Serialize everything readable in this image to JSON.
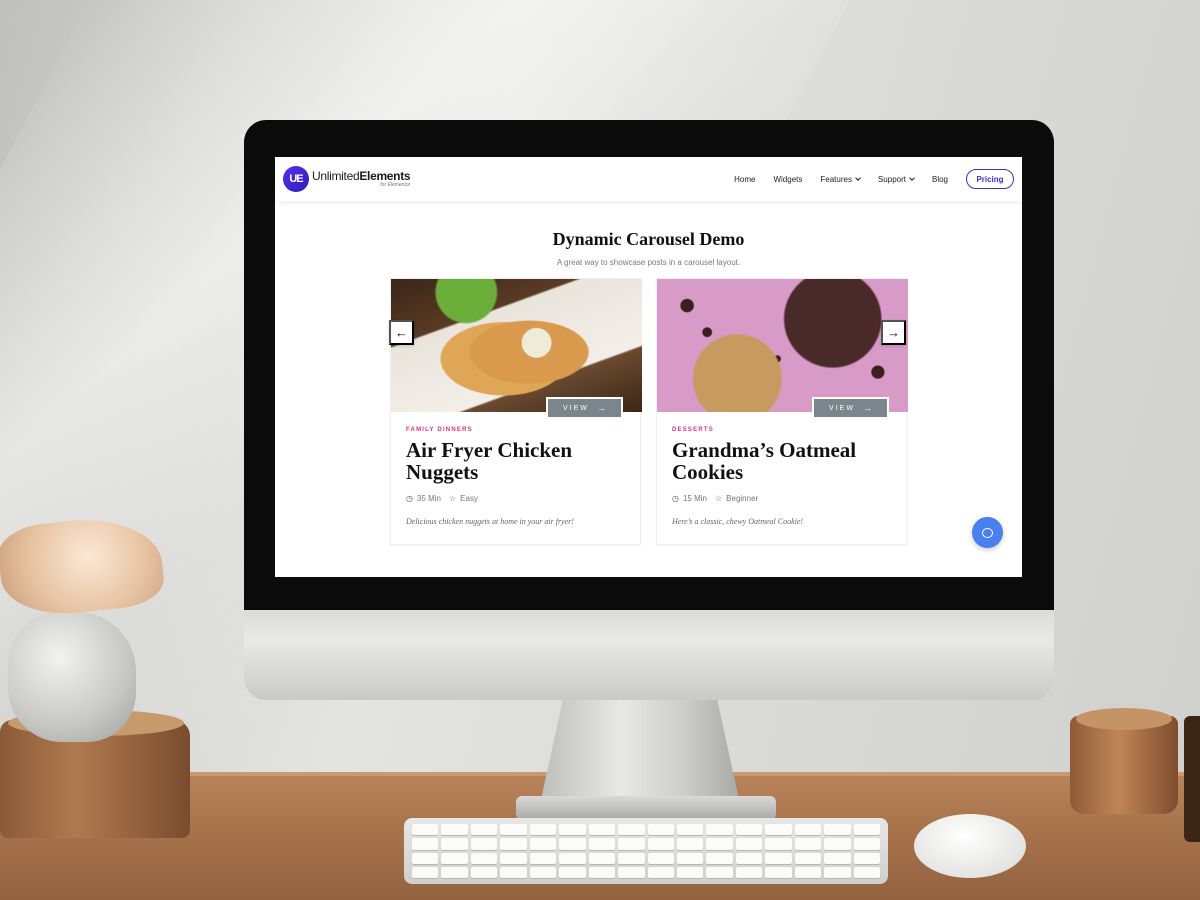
{
  "site": {
    "logo": {
      "mark": "UE",
      "brand_light": "Unlimited",
      "brand_bold": "Elements",
      "tagline": "for Elementor"
    },
    "nav": {
      "items": [
        {
          "label": "Home",
          "dropdown": false
        },
        {
          "label": "Widgets",
          "dropdown": false
        },
        {
          "label": "Features",
          "dropdown": true
        },
        {
          "label": "Support",
          "dropdown": true
        },
        {
          "label": "Blog",
          "dropdown": false
        }
      ],
      "pricing_label": "Pricing"
    }
  },
  "page": {
    "title": "Dynamic Carousel Demo",
    "subtitle": "A great way to showcase posts in a carousel layout."
  },
  "cards": [
    {
      "category": "FAMILY DINNERS",
      "title": "Air Fryer Chicken Nuggets",
      "time": "35 Min",
      "difficulty": "Easy",
      "description": "Delicious chicken nuggets at home in your air fryer!",
      "view_label": "VIEW",
      "image_icon": "chicken-nuggets-photo"
    },
    {
      "category": "DESSERTS",
      "title": "Grandma’s Oatmeal Cookies",
      "time": "15 Min",
      "difficulty": "Beginner",
      "description": "Here’s a classic, chewy Oatmeal Cookie!",
      "view_label": "VIEW",
      "image_icon": "oatmeal-cookies-photo"
    }
  ],
  "carousel": {
    "prev_icon": "arrow-left-icon",
    "next_icon": "arrow-right-icon"
  },
  "colors": {
    "accent": "#3a2fd8",
    "category": "#e0307a",
    "chat": "#4a7ff0",
    "view_button": "#7a868c"
  }
}
